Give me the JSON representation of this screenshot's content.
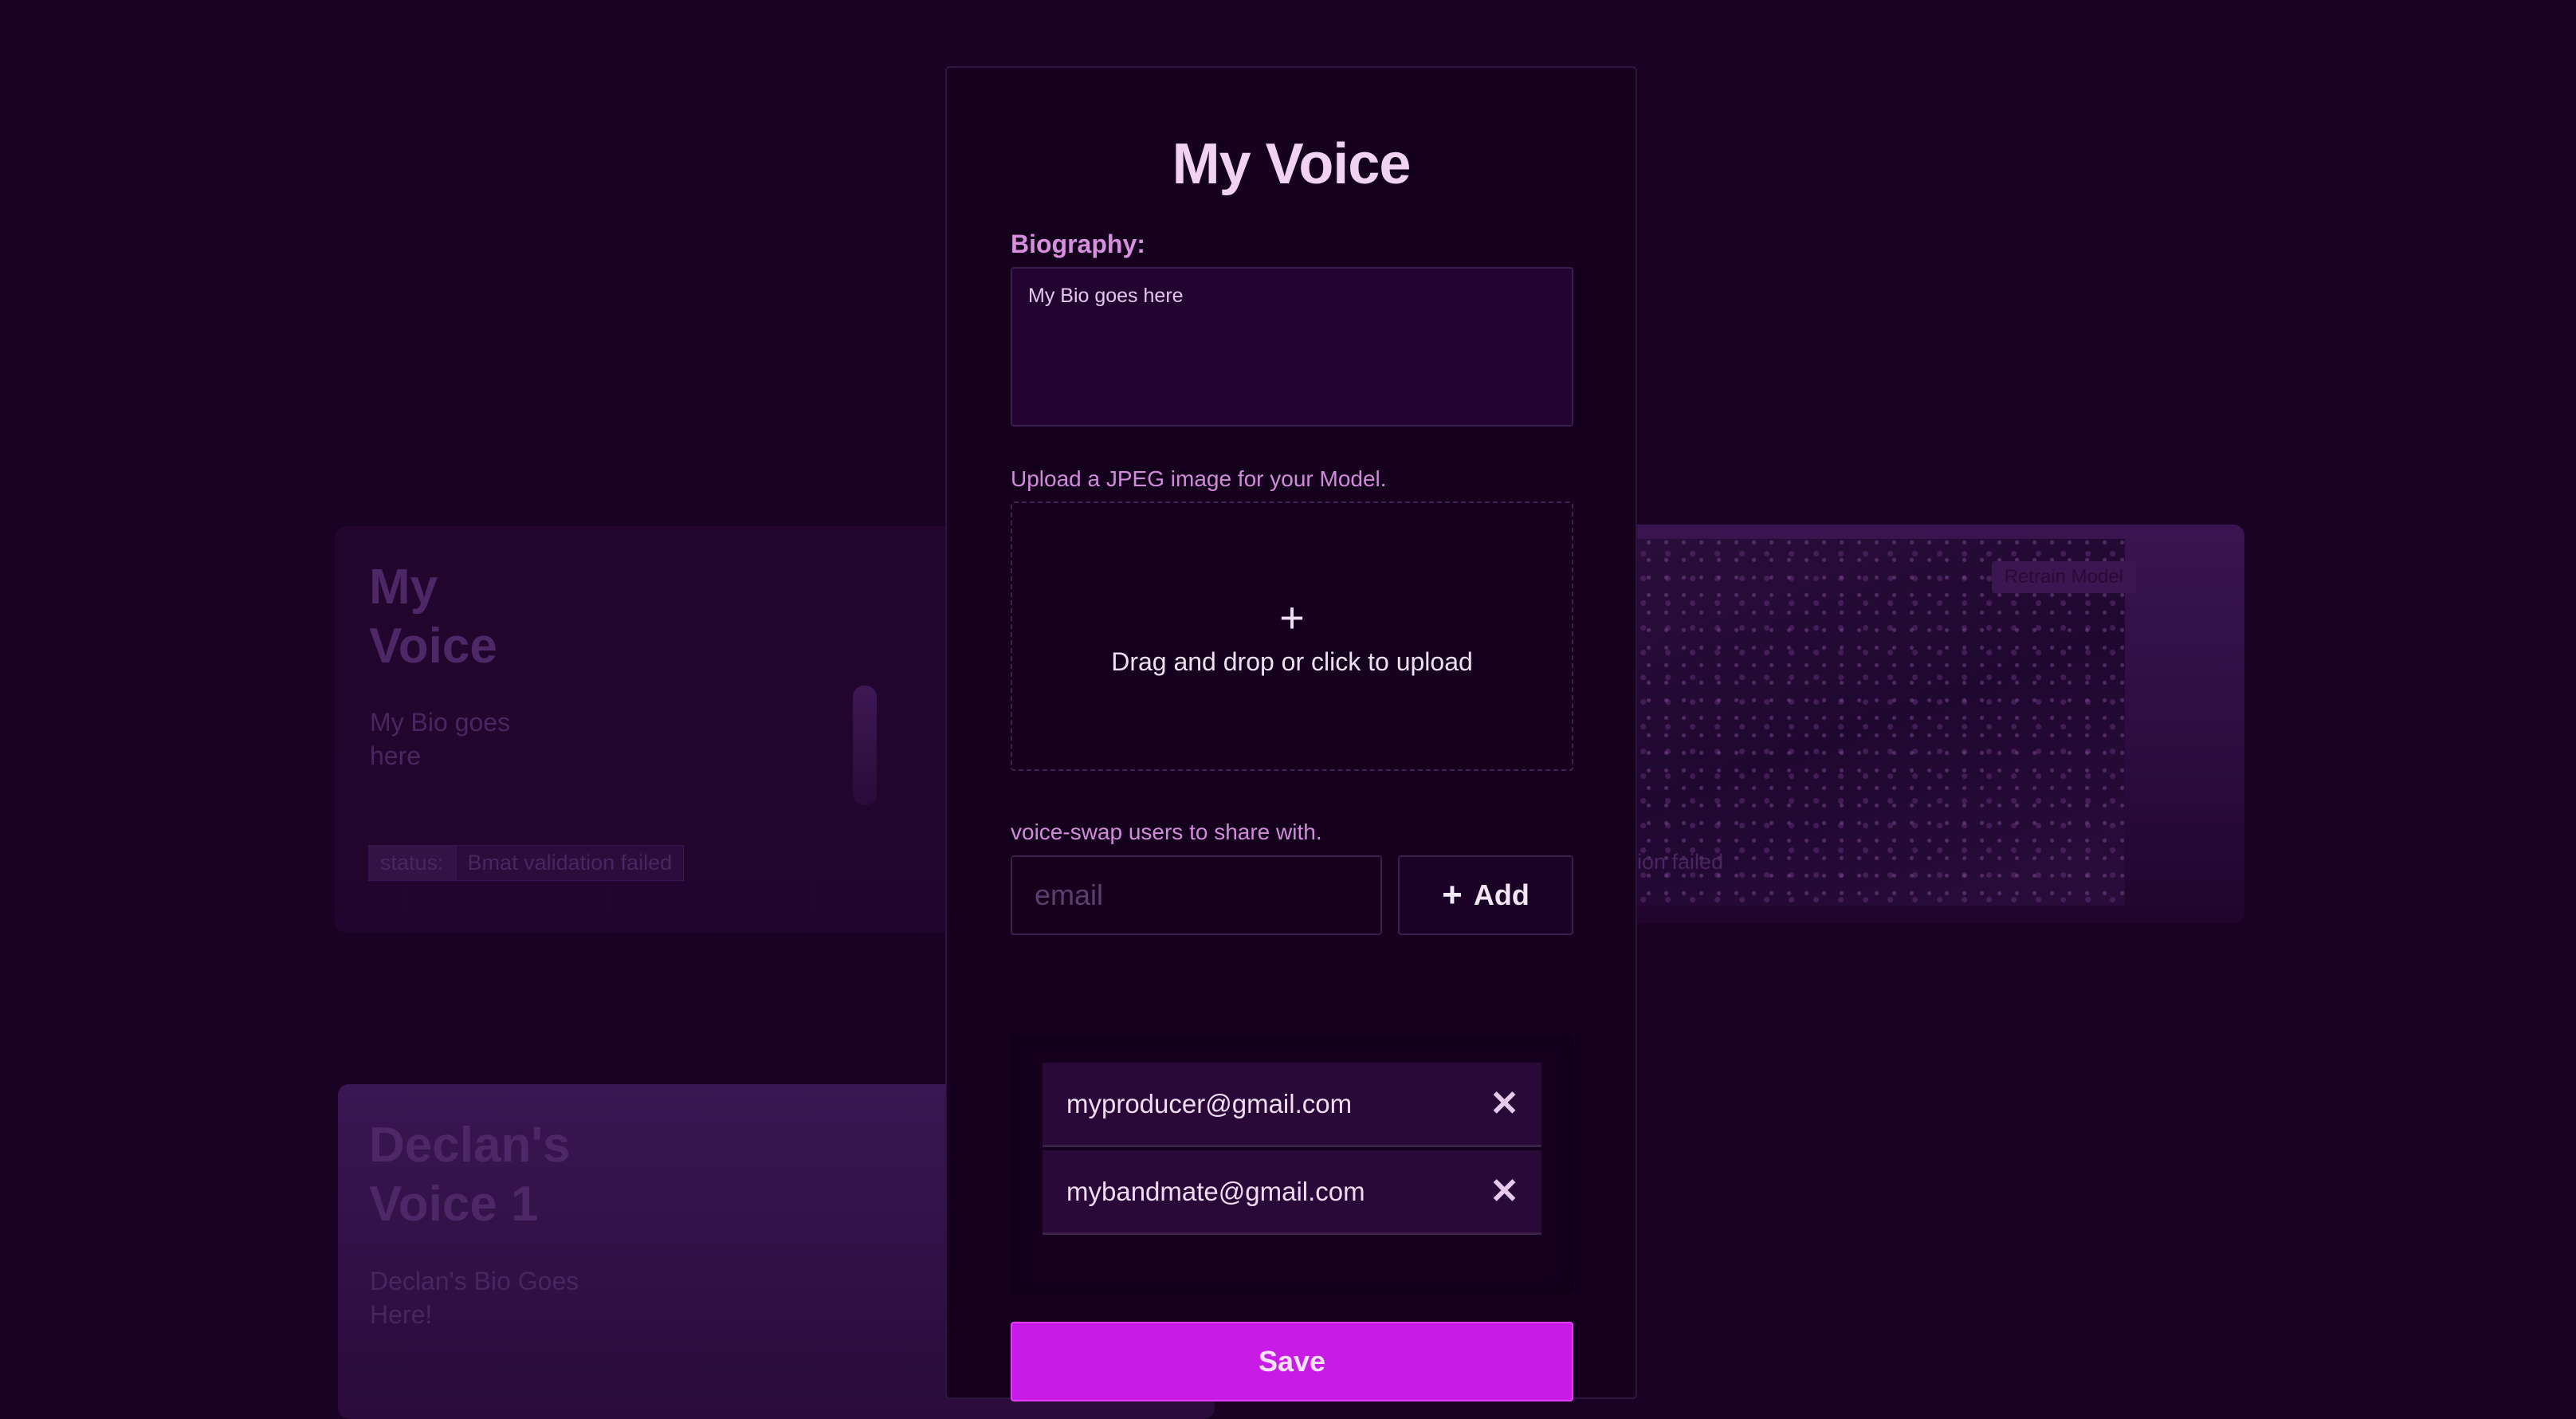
{
  "modal": {
    "title": "My Voice",
    "bio_label": "Biography:",
    "bio_value": "My Bio goes here",
    "upload_label": "Upload a JPEG image for your Model.",
    "dropzone_text": "Drag and drop or click to upload",
    "share_label": "voice-swap users to share with.",
    "email_placeholder": "email",
    "add_label": "Add",
    "shared_users": [
      {
        "email": "myproducer@gmail.com"
      },
      {
        "email": "mybandmate@gmail.com"
      }
    ],
    "save_label": "Save"
  },
  "background": {
    "card1": {
      "title_line1": "My",
      "title_line2": "Voice",
      "bio_line1": "My Bio goes",
      "bio_line2": "here",
      "status_key": "status:",
      "status_value": "Bmat validation failed"
    },
    "card2": {
      "retrain_label": "Retrain Model",
      "status_value_partial": "ion failed"
    },
    "card3": {
      "title_line1": "Declan's",
      "title_line2": "Voice 1",
      "bio_line1": "Declan's Bio Goes",
      "bio_line2": "Here!"
    }
  },
  "colors": {
    "page_bg": "#1a0224",
    "modal_bg": "#15011e",
    "accent": "#c91be6",
    "label_pink": "#d88fe0"
  }
}
